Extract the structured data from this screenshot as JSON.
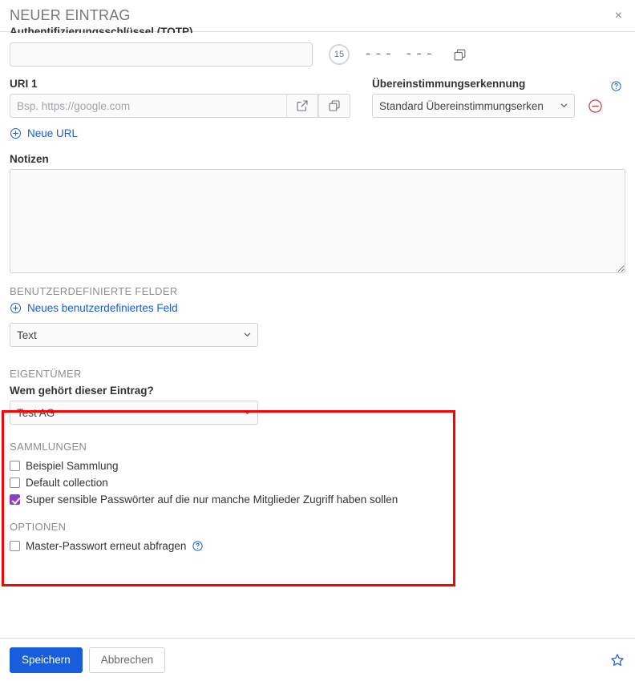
{
  "header": {
    "title": "NEUER EINTRAG",
    "close_label": "×"
  },
  "totp": {
    "label": "Authentifizierungsschlüssel (TOTP)",
    "value": "",
    "placeholder": "",
    "countdown": "15",
    "code_placeholder": "--- ---",
    "copy_icon": "copy-icon"
  },
  "uri": {
    "label": "URI 1",
    "placeholder": "Bsp. https://google.com",
    "value": "",
    "launch_icon": "external-link-icon",
    "copy_icon": "copy-icon",
    "match_label": "Übereinstimmungserkennung",
    "match_help_icon": "help-circle-icon",
    "match_selected": "Standard Übereinstimmungserken",
    "match_options": [
      "Standard Übereinstimmungserken"
    ],
    "remove_icon": "minus-circle-icon",
    "add_url_label": "Neue URL",
    "add_icon": "plus-circle-icon"
  },
  "notes": {
    "label": "Notizen",
    "value": "",
    "placeholder": ""
  },
  "custom_fields": {
    "section_title": "BENUTZERDEFINIERTE FELDER",
    "add_label": "Neues benutzerdefiniertes Feld",
    "add_icon": "plus-circle-icon",
    "type_selected": "Text",
    "type_options": [
      "Text"
    ]
  },
  "owner": {
    "section_title": "EIGENTÜMER",
    "question": "Wem gehört dieser Eintrag?",
    "selected": "Test AG",
    "options": [
      "Test AG"
    ]
  },
  "collections": {
    "section_title": "SAMMLUNGEN",
    "items": [
      {
        "label": "Beispiel Sammlung",
        "checked": false
      },
      {
        "label": "Default collection",
        "checked": false
      },
      {
        "label": "Super sensible Passwörter auf die nur manche Mitglieder Zugriff haben sollen",
        "checked": true
      }
    ]
  },
  "options": {
    "section_title": "OPTIONEN",
    "reprompt_label": "Master-Passwort erneut abfragen",
    "reprompt_checked": false,
    "help_icon": "help-circle-icon"
  },
  "footer": {
    "save_label": "Speichern",
    "cancel_label": "Abbrechen",
    "favorite_icon": "star-outline-icon"
  },
  "colors": {
    "accent": "#175ddc",
    "highlight": "#ff0000",
    "checkbox_checked": "#8b3fc7",
    "danger": "#c83e3e",
    "muted": "#8a8f94"
  }
}
